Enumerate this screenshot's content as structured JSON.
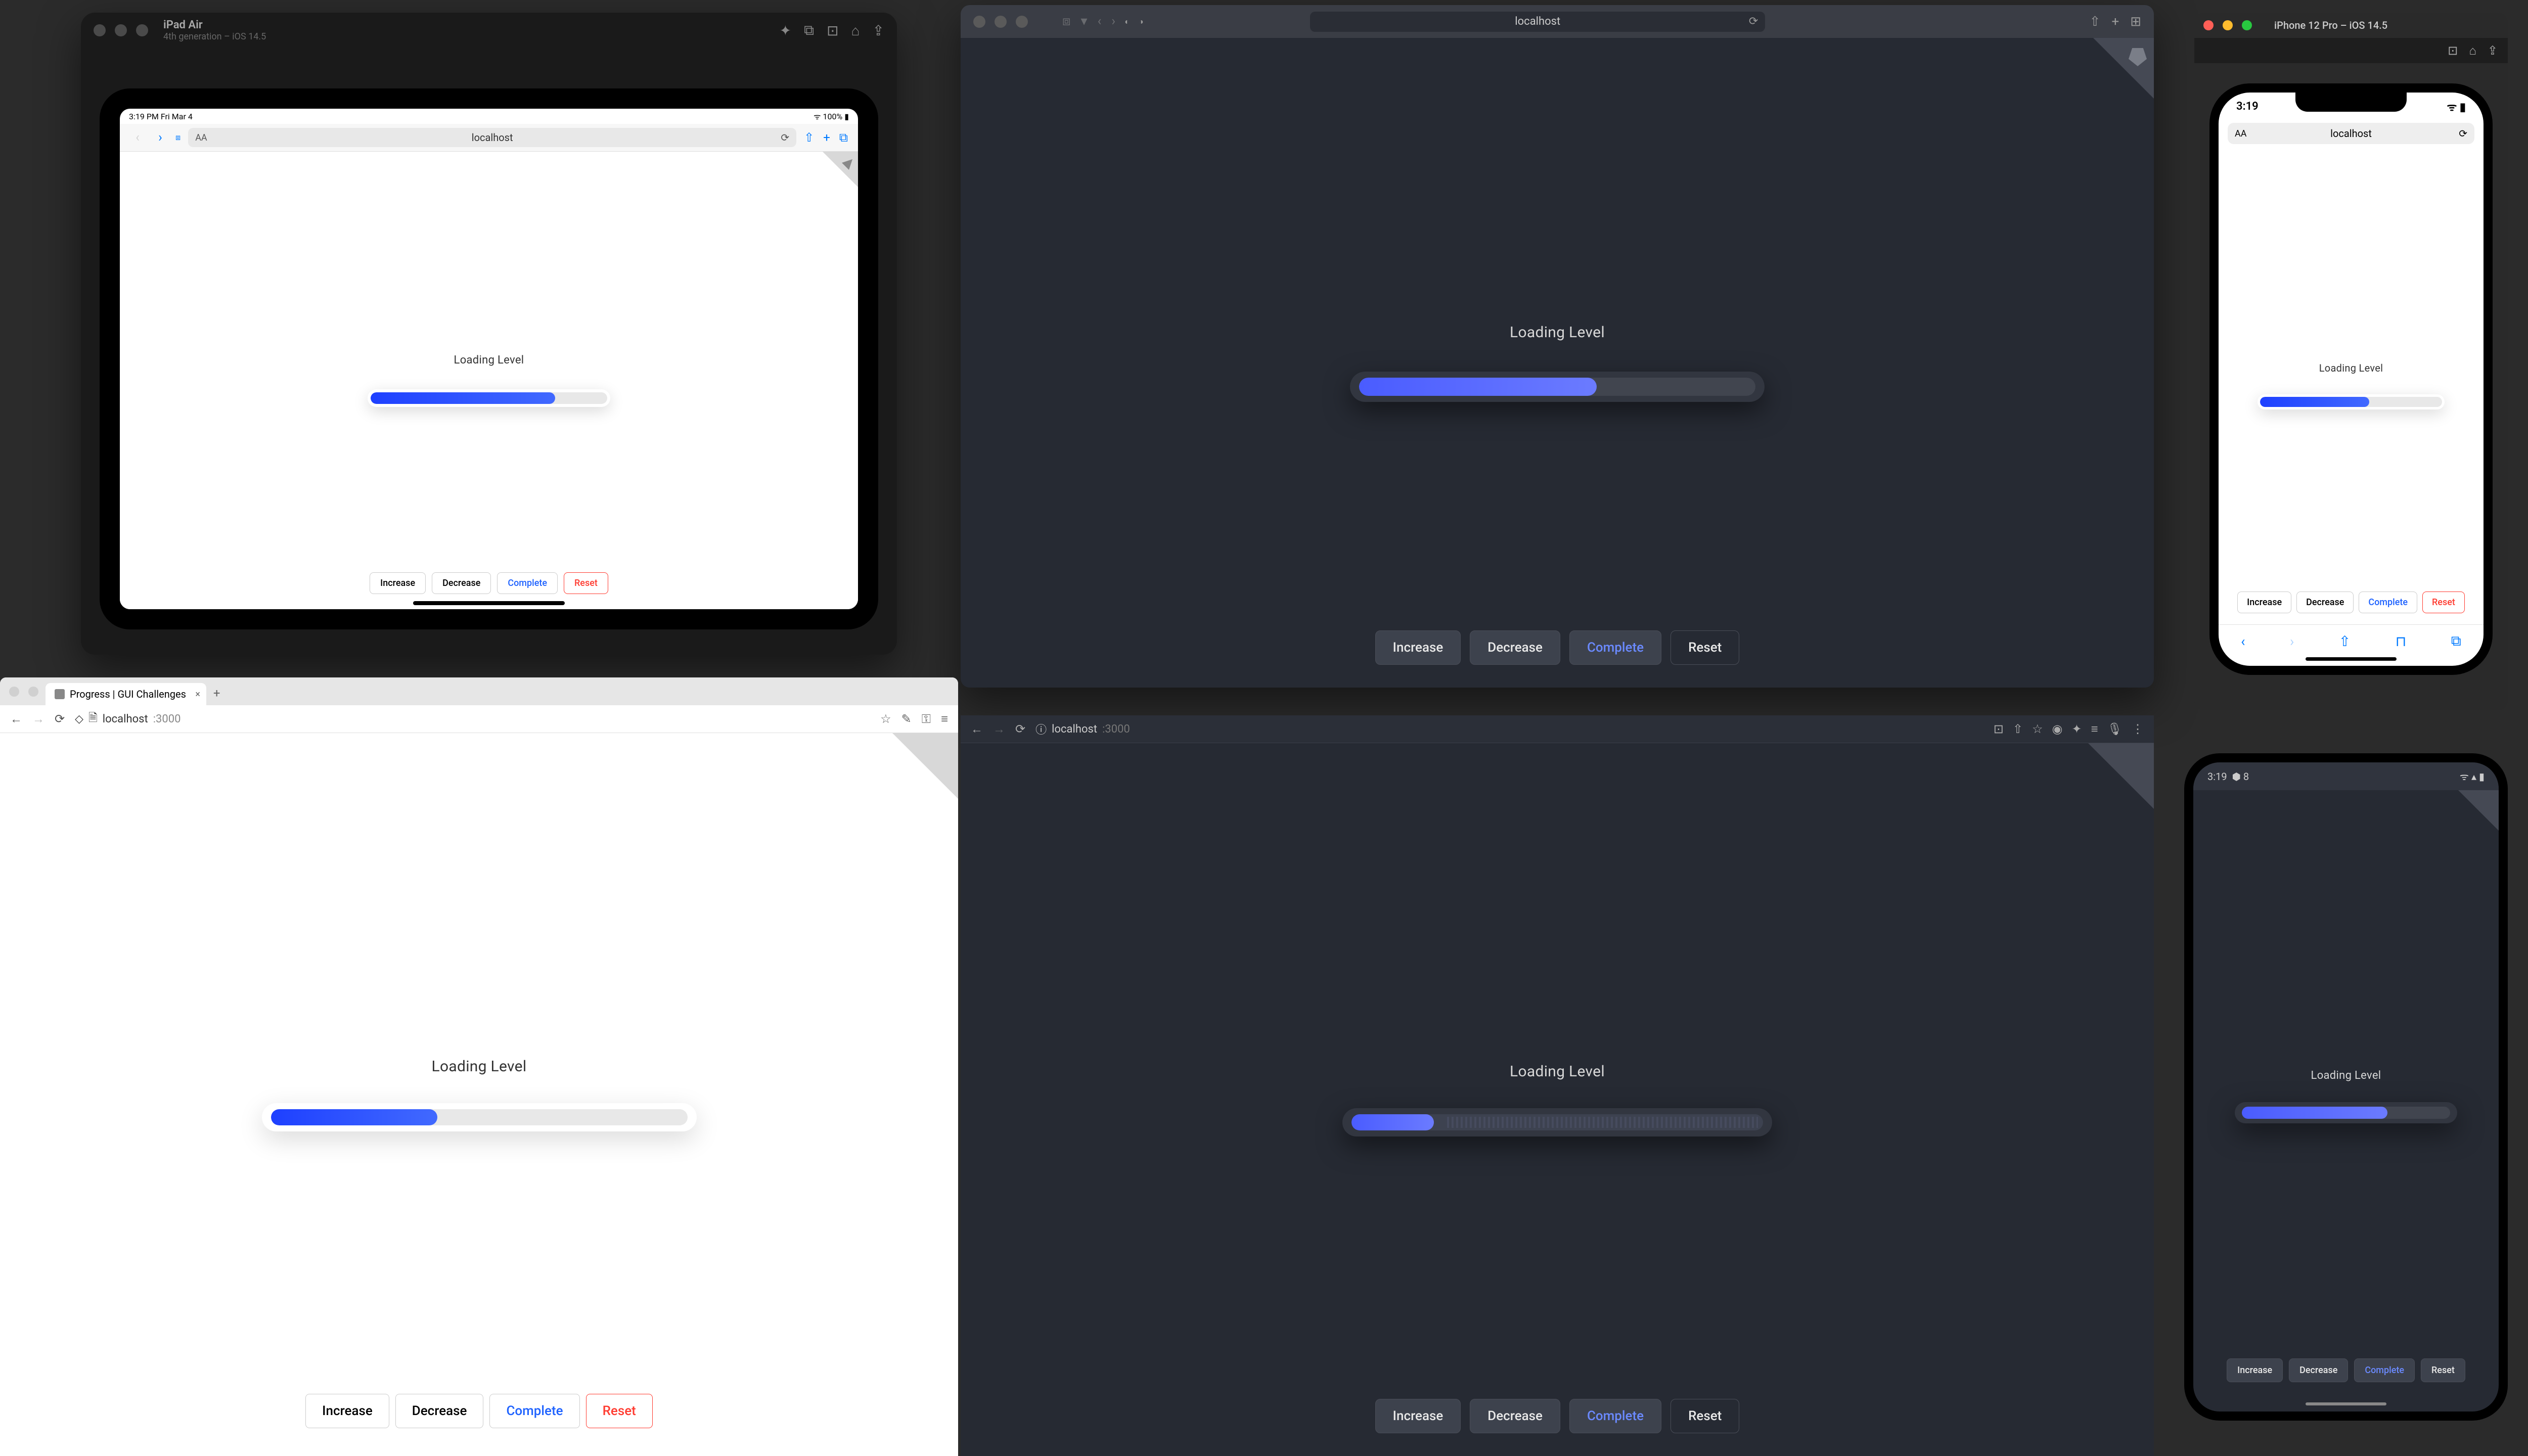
{
  "ipad": {
    "window_title": "iPad Air",
    "window_subtitle": "4th generation – iOS 14.5",
    "status_time": "3:19 PM  Fri Mar 4",
    "status_right": "100%",
    "url": "localhost",
    "demo": {
      "label": "Loading Level",
      "progress_pct": 78,
      "buttons": {
        "increase": "Increase",
        "decrease": "Decrease",
        "complete": "Complete",
        "reset": "Reset"
      }
    }
  },
  "safari_dark": {
    "url": "localhost",
    "demo": {
      "label": "Loading Level",
      "progress_pct": 60,
      "buttons": {
        "increase": "Increase",
        "decrease": "Decrease",
        "complete": "Complete",
        "reset": "Reset"
      }
    }
  },
  "iphone": {
    "window_title": "iPhone 12 Pro – iOS 14.5",
    "status_time": "3:19",
    "url": "localhost",
    "demo": {
      "label": "Loading Level",
      "progress_pct": 60,
      "buttons": {
        "increase": "Increase",
        "decrease": "Decrease",
        "complete": "Complete",
        "reset": "Reset"
      }
    }
  },
  "browser_light": {
    "tab_title": "Progress | GUI Challenges",
    "url_host": "localhost",
    "url_port": ":3000",
    "demo": {
      "label": "Loading Level",
      "progress_pct": 40,
      "buttons": {
        "increase": "Increase",
        "decrease": "Decrease",
        "complete": "Complete",
        "reset": "Reset"
      }
    }
  },
  "browser_dark": {
    "url_host": "localhost",
    "url_port": ":3000",
    "demo": {
      "label": "Loading Level",
      "progress_pct": 20,
      "buttons": {
        "increase": "Increase",
        "decrease": "Decrease",
        "complete": "Complete",
        "reset": "Reset"
      }
    }
  },
  "android": {
    "status_time": "3:19",
    "status_icons": "8",
    "demo": {
      "label": "Loading Level",
      "progress_pct": 70,
      "buttons": {
        "increase": "Increase",
        "decrease": "Decrease",
        "complete": "Complete",
        "reset": "Reset"
      }
    }
  }
}
